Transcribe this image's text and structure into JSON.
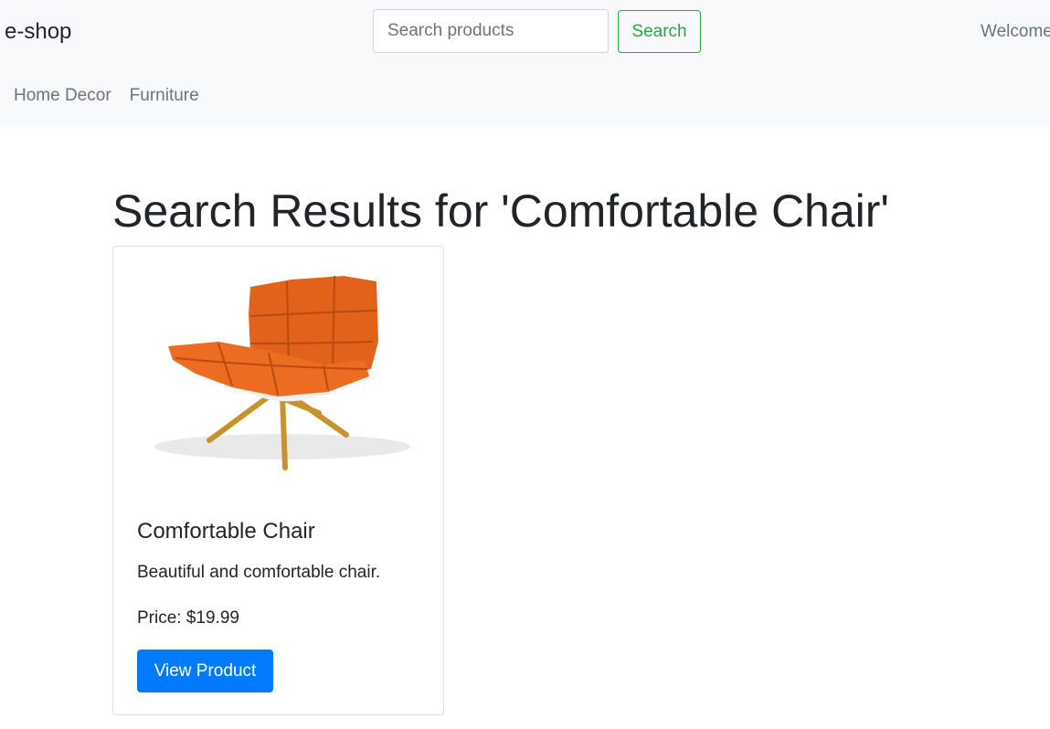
{
  "navbar": {
    "brand": "e-shop",
    "search": {
      "placeholder": "Search products",
      "value": ""
    },
    "search_button_label": "Search",
    "welcome_text": "Welcome",
    "links": [
      {
        "label": "Home Decor"
      },
      {
        "label": "Furniture"
      }
    ]
  },
  "main": {
    "title": "Search Results for 'Comfortable Chair'",
    "products": [
      {
        "name": "Comfortable Chair",
        "description": "Beautiful and comfortable chair.",
        "price_text": "Price: $19.99",
        "button_label": "View Product",
        "image": "orange-lounge-chair-photo"
      }
    ]
  },
  "colors": {
    "navbar_bg": "#f8f9fa",
    "search_accent": "#28a745",
    "primary": "#007bff",
    "chair_orange": "#e2621b",
    "chair_legs": "#c8922e"
  }
}
